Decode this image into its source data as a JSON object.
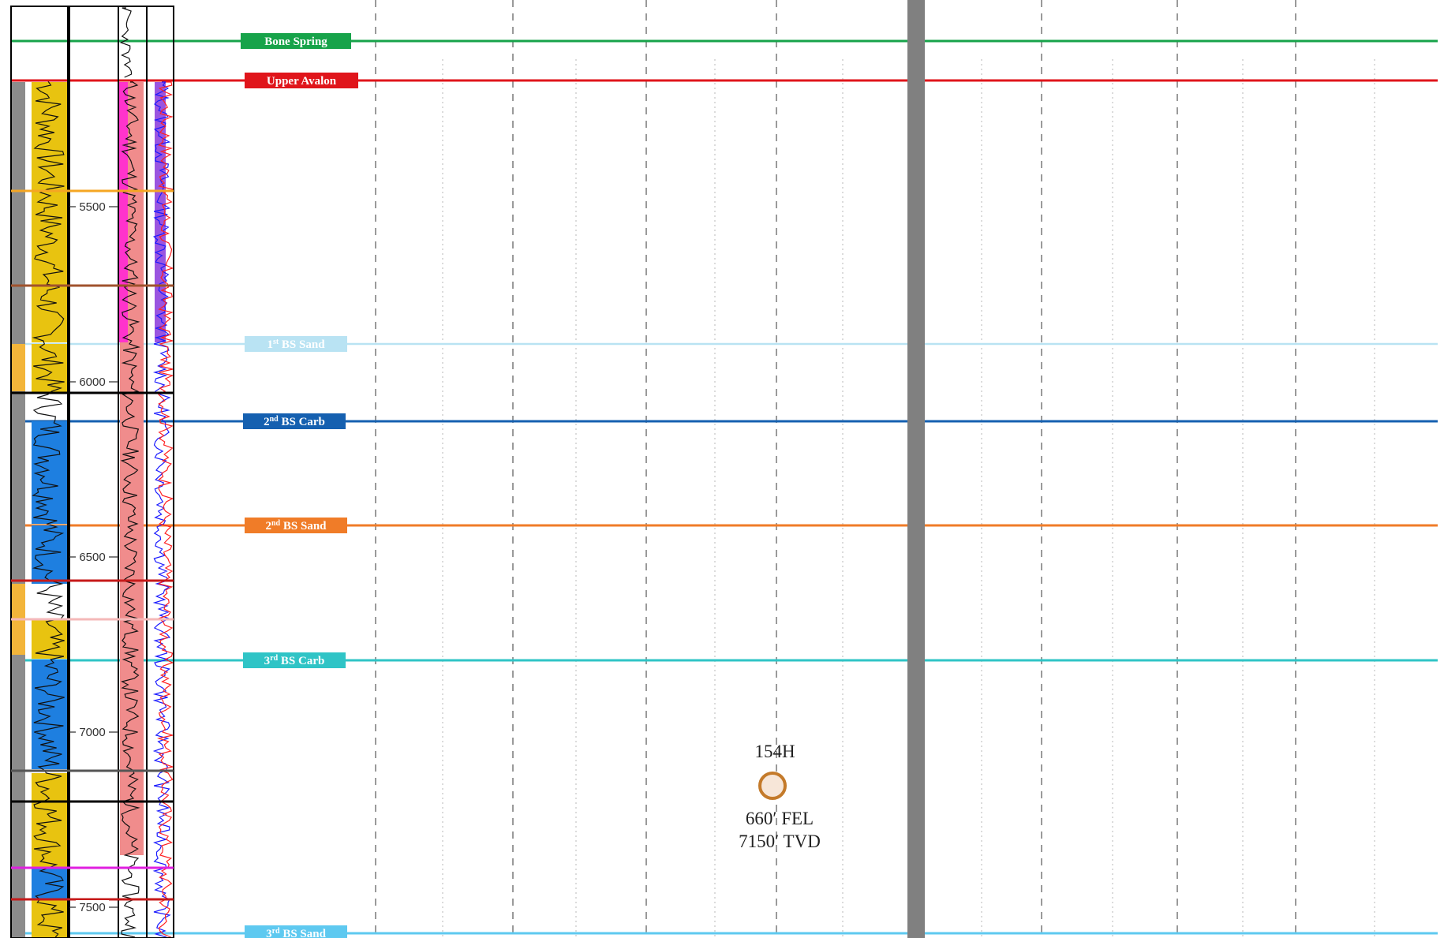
{
  "formations": [
    {
      "name": "Bone Spring",
      "sup": "",
      "color": "#17a34a"
    },
    {
      "name": "Upper Avalon",
      "sup": "",
      "color": "#e0151b"
    },
    {
      "name": "1",
      "sup": "st",
      "rest": " BS Sand",
      "color": "#b9e3f3"
    },
    {
      "name": "2",
      "sup": "nd",
      "rest": " BS Carb",
      "color": "#1560b0"
    },
    {
      "name": "2",
      "sup": "nd",
      "rest": " BS Sand",
      "color": "#f07c28"
    },
    {
      "name": "3",
      "sup": "rd",
      "rest": " BS Carb",
      "color": "#2fc4c6"
    },
    {
      "name": "3",
      "sup": "rd",
      "rest": " BS Sand",
      "color": "#5ec9f0"
    }
  ],
  "depth_ticks": [
    "5500",
    "6000",
    "6500",
    "7000",
    "7500"
  ],
  "well": {
    "name": "154H",
    "line1": "660′ FEL",
    "line2": "7150′ TVD",
    "marker_fill": "#f7e6d8",
    "marker_stroke": "#c47a2a"
  },
  "section_line_color": "#808080"
}
